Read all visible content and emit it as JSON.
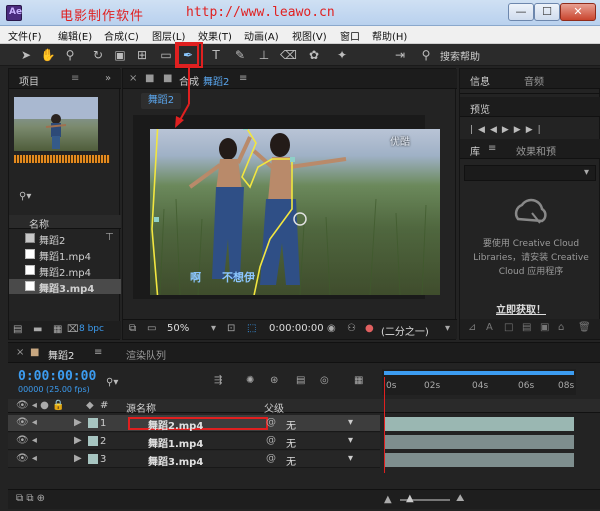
{
  "watermark": {
    "name": "电影制作软件",
    "url": "http://www.leawo.cn"
  },
  "window": {
    "minimize": "—",
    "maximize": "☐",
    "close": "✕"
  },
  "menu": [
    "文件(F)",
    "编辑(E)",
    "合成(C)",
    "图层(L)",
    "效果(T)",
    "动画(A)",
    "视图(V)",
    "窗口",
    "帮助(H)"
  ],
  "toolbar": {
    "help_search": "搜索帮助"
  },
  "project": {
    "tab": "项目",
    "name_header": "名称",
    "items": [
      {
        "label": "舞蹈2",
        "type": "comp"
      },
      {
        "label": "舞蹈1.mp4",
        "type": "footage"
      },
      {
        "label": "舞蹈2.mp4",
        "type": "footage"
      },
      {
        "label": "舞蹈3.mp4",
        "type": "footage"
      }
    ],
    "bpc": "8 bpc"
  },
  "composition": {
    "tab": "合成",
    "tab_suffix": "舞蹈2",
    "subtab": "舞蹈2",
    "watermark_corner": "优酷",
    "subtitle_left": "啊",
    "subtitle_right": "不想伊",
    "zoom": "50%",
    "timecode": "0:00:00:00",
    "resolution": "(二分之一)"
  },
  "right": {
    "info_tab": "信息",
    "audio_tab": "音频",
    "preview_tab": "预览",
    "library_tab": "库",
    "effects_tab": "效果和预",
    "message": "要使用 Creative Cloud Libraries，请安装 Creative Cloud 应用程序",
    "get_now": "立即获取！"
  },
  "timeline": {
    "tab": "舞蹈2",
    "render_tab": "渲染队列",
    "time": "0:00:00:00",
    "fps": "00000 (25.00 fps)",
    "col_num": "#",
    "col_source": "源名称",
    "col_parent": "父级",
    "ticks": [
      "0s",
      "02s",
      "04s",
      "06s",
      "08s"
    ],
    "layers": [
      {
        "num": "1",
        "name": "舞蹈2.mp4",
        "parent": "无",
        "selected": true
      },
      {
        "num": "2",
        "name": "舞蹈1.mp4",
        "parent": "无",
        "selected": false
      },
      {
        "num": "3",
        "name": "舞蹈3.mp4",
        "parent": "无",
        "selected": false
      }
    ]
  },
  "colors": {
    "accent_red": "#e02020",
    "timecode_blue": "#3c9cf0",
    "mask_yellow": "#f2e640"
  }
}
